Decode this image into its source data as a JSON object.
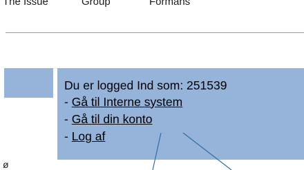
{
  "nav": {
    "items": [
      "The Issue",
      "Group",
      "Formans"
    ]
  },
  "login_box": {
    "status_text": "Du er logged Ind som: 251539",
    "link_prefix": "- ",
    "links": [
      "Gå til Interne system",
      "Gå til din konto",
      "Log af"
    ]
  },
  "stray_text": "ø",
  "colors": {
    "box_blue": "#96b3d9",
    "callout_line": "#2f6f9f"
  }
}
